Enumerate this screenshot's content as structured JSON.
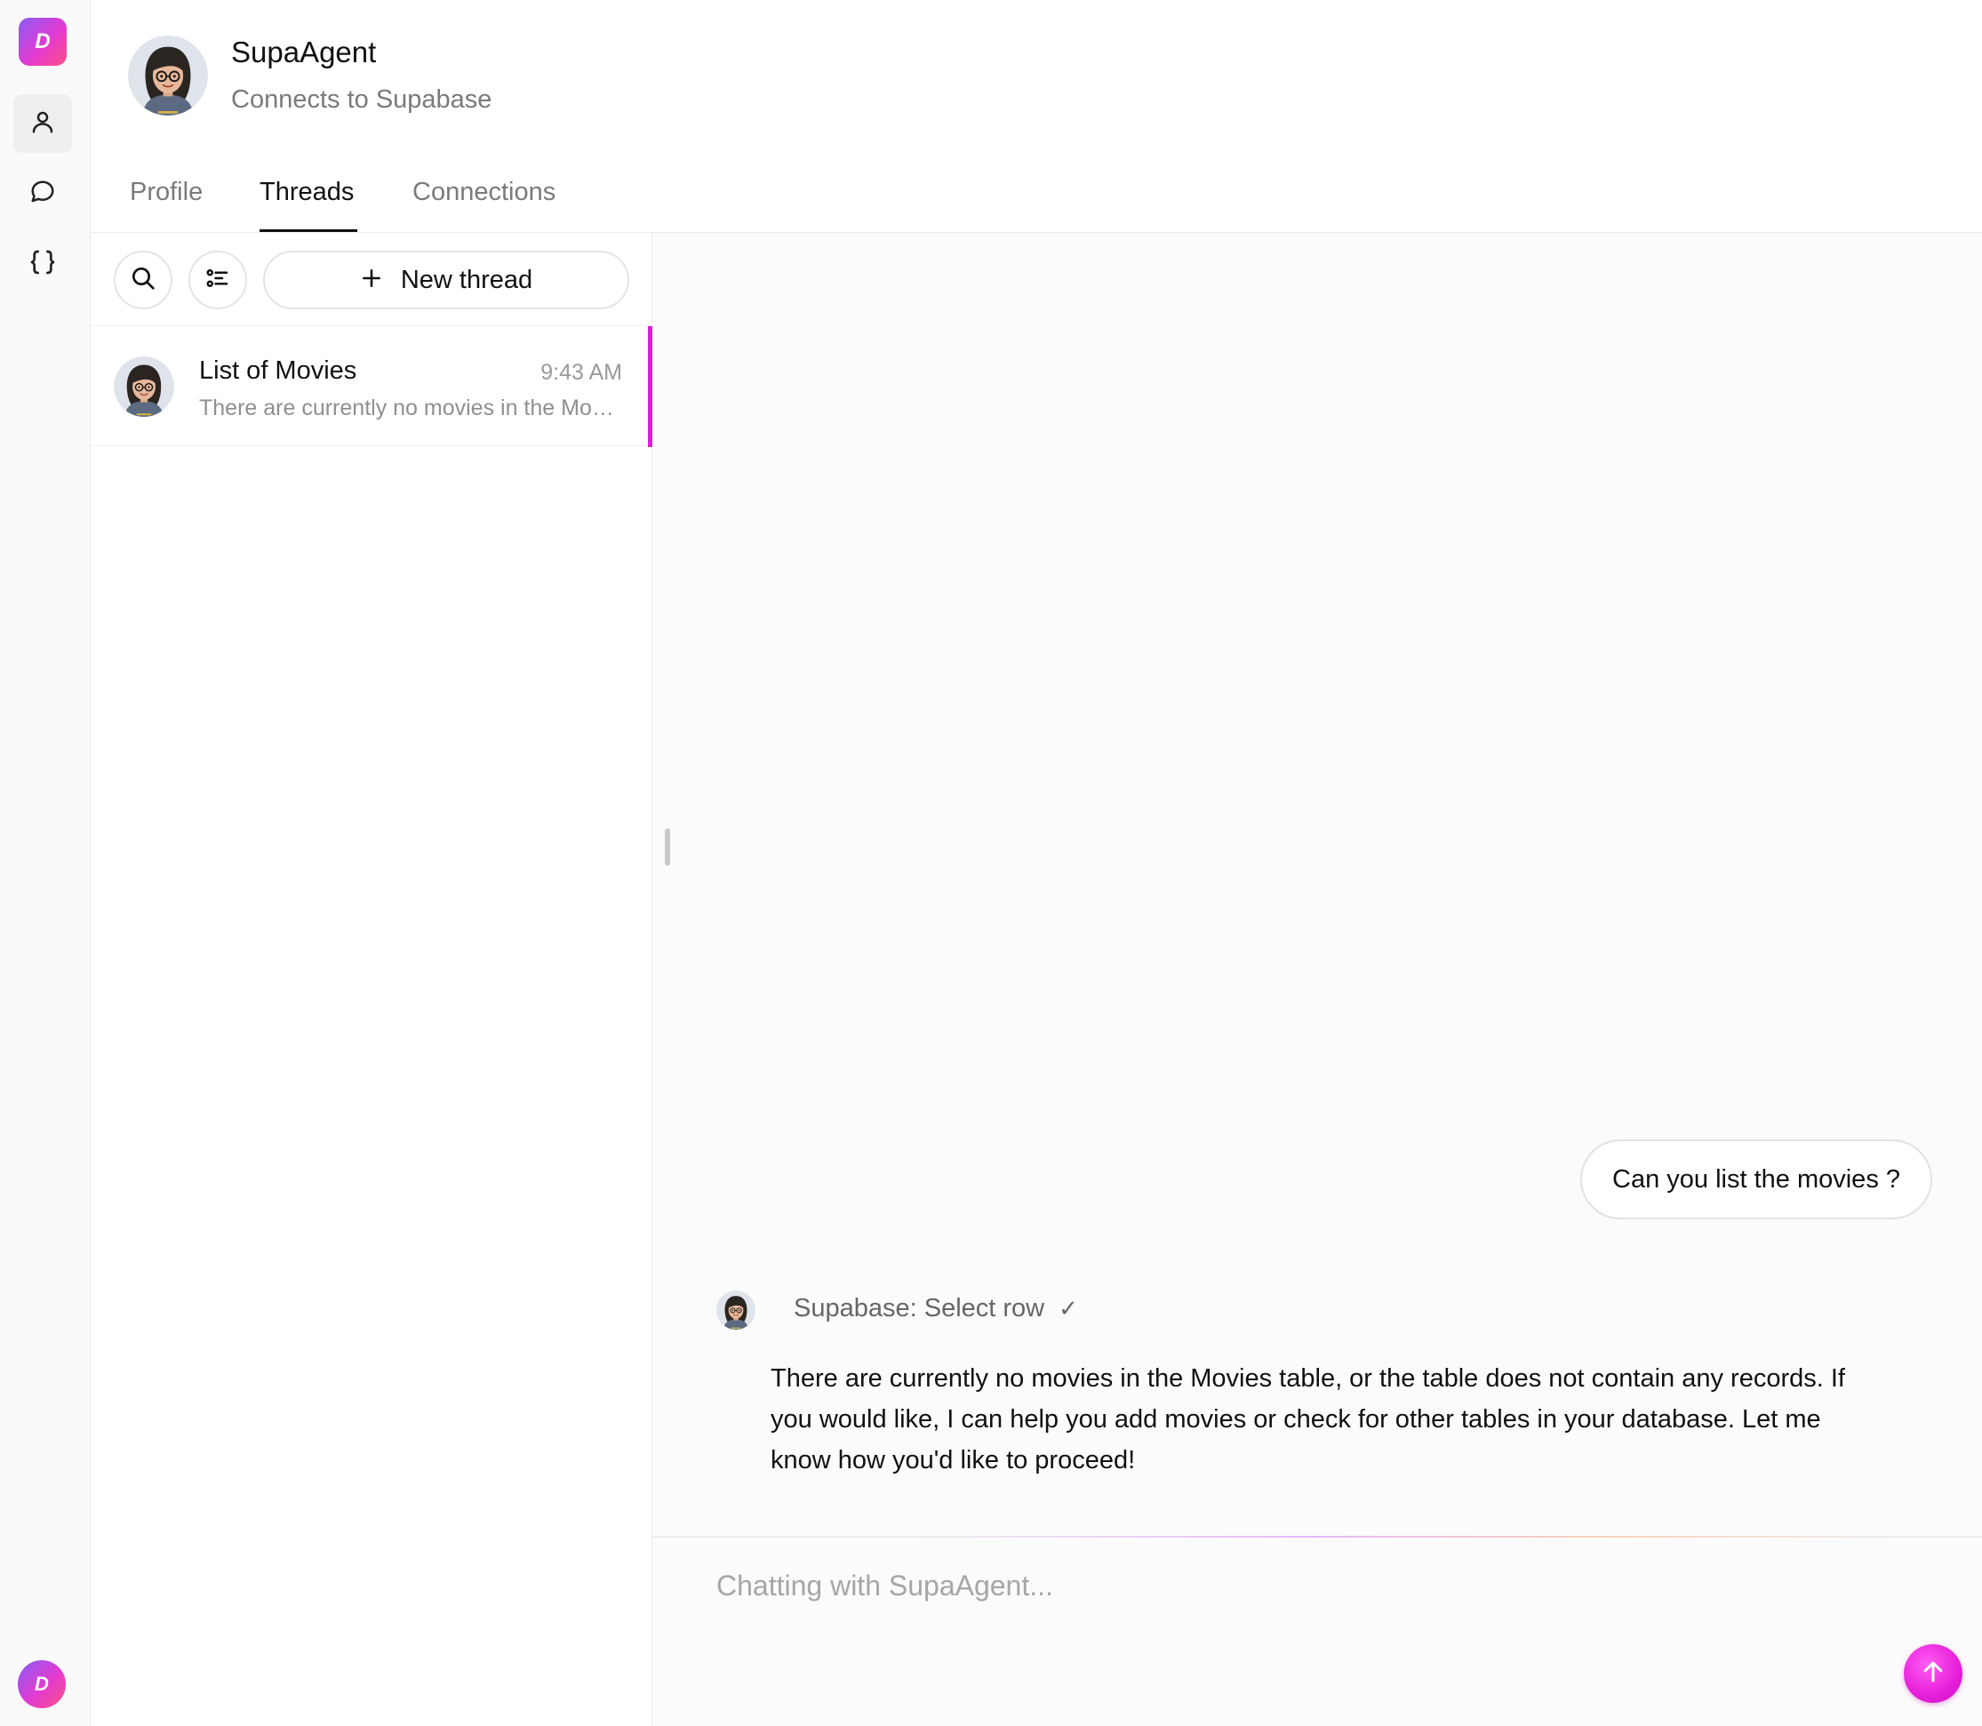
{
  "app": {
    "logo_letter": "D",
    "user_initial": "D",
    "brand_gradient": [
      "#8a5cf6",
      "#e23bd0",
      "#ff4f86"
    ],
    "accent_color": "#d61fd6"
  },
  "rail": {
    "items": [
      {
        "icon": "person-icon",
        "active": true
      },
      {
        "icon": "chat-bubble-icon",
        "active": false
      },
      {
        "icon": "code-braces-icon",
        "active": false
      }
    ]
  },
  "agent": {
    "name": "SupaAgent",
    "subtitle": "Connects to Supabase",
    "avatar_icon": "agent-avatar-icon"
  },
  "tabs": [
    {
      "label": "Profile",
      "active": false
    },
    {
      "label": "Threads",
      "active": true
    },
    {
      "label": "Connections",
      "active": false
    }
  ],
  "threads_panel": {
    "search_icon": "search-icon",
    "filter_icon": "list-filter-icon",
    "new_thread_label": "New thread",
    "items": [
      {
        "title": "List of Movies",
        "time": "9:43 AM",
        "preview": "There are currently no movies in the Movies table, or the table does not contain any records.",
        "selected": true
      }
    ]
  },
  "chat": {
    "user_message": "Can you list the movies ?",
    "tool_call": {
      "label": "Supabase: Select row",
      "status_icon": "check-icon",
      "status_glyph": "✓"
    },
    "assistant_message": "There are currently no movies in the Movies table, or the table does not contain any records. If you would like, I can help you add movies or check for other tables in your database. Let me know how you'd like to proceed!"
  },
  "composer": {
    "placeholder": "Chatting with SupaAgent...",
    "value": "",
    "send_icon": "arrow-up-icon"
  }
}
